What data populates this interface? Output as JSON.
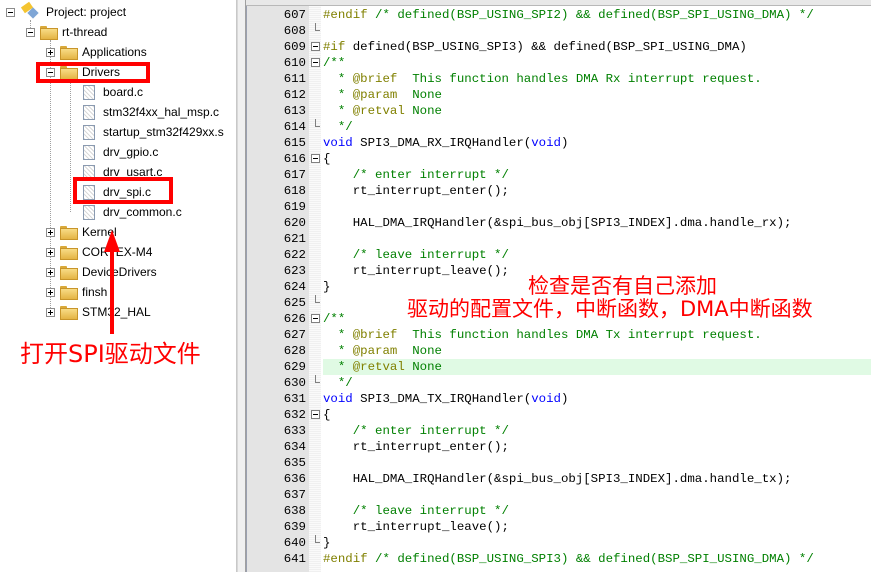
{
  "project_tree": {
    "root": "Project: project",
    "group": "rt-thread",
    "folders_before": [
      {
        "label": "Applications",
        "expanded": false
      }
    ],
    "drivers": {
      "label": "Drivers",
      "expanded": true,
      "files": [
        "board.c",
        "stm32f4xx_hal_msp.c",
        "startup_stm32f429xx.s",
        "drv_gpio.c",
        "drv_usart.c",
        "drv_spi.c",
        "drv_common.c"
      ]
    },
    "folders_after": [
      {
        "label": "Kernel",
        "expanded": false
      },
      {
        "label": "CORTEX-M4",
        "expanded": false
      },
      {
        "label": "DeviceDrivers",
        "expanded": false
      },
      {
        "label": "finsh",
        "expanded": false
      },
      {
        "label": "STM32_HAL",
        "expanded": false
      }
    ],
    "highlighted": [
      "Drivers",
      "drv_spi.c"
    ]
  },
  "annotations": {
    "left": "打开SPI驱动文件",
    "right_line1": "检查是否有自己添加",
    "right_line2": "驱动的配置文件，中断函数，DMA中断函数",
    "color": "#ff0000"
  },
  "editor": {
    "highlighted_line": 629,
    "lines": [
      {
        "n": "607",
        "fold": "none",
        "segs": [
          [
            "p",
            "#endif"
          ],
          [
            "c",
            " /* defined(BSP_USING_SPI2) && defined(BSP_SPI_USING_DMA) */"
          ]
        ]
      },
      {
        "n": "608",
        "fold": "tick",
        "segs": []
      },
      {
        "n": "609",
        "fold": "box",
        "segs": [
          [
            "p",
            "#if"
          ],
          [
            "d",
            " defined(BSP_USING_SPI3) && defined(BSP_SPI_USING_DMA)"
          ]
        ]
      },
      {
        "n": "610",
        "fold": "box",
        "segs": [
          [
            "c",
            "/**"
          ]
        ]
      },
      {
        "n": "611",
        "fold": "none",
        "segs": [
          [
            "c",
            "  * "
          ],
          [
            "p",
            "@brief"
          ],
          [
            "c",
            "  This function handles DMA Rx interrupt request."
          ]
        ]
      },
      {
        "n": "612",
        "fold": "none",
        "segs": [
          [
            "c",
            "  * "
          ],
          [
            "p",
            "@param"
          ],
          [
            "c",
            "  None"
          ]
        ]
      },
      {
        "n": "613",
        "fold": "none",
        "segs": [
          [
            "c",
            "  * "
          ],
          [
            "p",
            "@retval"
          ],
          [
            "c",
            " None"
          ]
        ]
      },
      {
        "n": "614",
        "fold": "tick",
        "segs": [
          [
            "c",
            "  */"
          ]
        ]
      },
      {
        "n": "615",
        "fold": "none",
        "segs": [
          [
            "k",
            "void"
          ],
          [
            "d",
            " SPI3_DMA_RX_IRQHandler("
          ],
          [
            "k",
            "void"
          ],
          [
            "d",
            ")"
          ]
        ]
      },
      {
        "n": "616",
        "fold": "box",
        "segs": [
          [
            "d",
            "{"
          ]
        ]
      },
      {
        "n": "617",
        "fold": "none",
        "segs": [
          [
            "c",
            "    /* enter interrupt */"
          ]
        ]
      },
      {
        "n": "618",
        "fold": "none",
        "segs": [
          [
            "d",
            "    rt_interrupt_enter();"
          ]
        ]
      },
      {
        "n": "619",
        "fold": "none",
        "segs": []
      },
      {
        "n": "620",
        "fold": "none",
        "segs": [
          [
            "d",
            "    HAL_DMA_IRQHandler(&spi_bus_obj[SPI3_INDEX].dma.handle_rx);"
          ]
        ]
      },
      {
        "n": "621",
        "fold": "none",
        "segs": []
      },
      {
        "n": "622",
        "fold": "none",
        "segs": [
          [
            "c",
            "    /* leave interrupt */"
          ]
        ]
      },
      {
        "n": "623",
        "fold": "none",
        "segs": [
          [
            "d",
            "    rt_interrupt_leave();"
          ]
        ]
      },
      {
        "n": "624",
        "fold": "none",
        "segs": [
          [
            "d",
            "}"
          ]
        ]
      },
      {
        "n": "625",
        "fold": "tick",
        "segs": []
      },
      {
        "n": "626",
        "fold": "box",
        "segs": [
          [
            "c",
            "/**"
          ]
        ]
      },
      {
        "n": "627",
        "fold": "none",
        "segs": [
          [
            "c",
            "  * "
          ],
          [
            "p",
            "@brief"
          ],
          [
            "c",
            "  This function handles DMA Tx interrupt request."
          ]
        ]
      },
      {
        "n": "628",
        "fold": "none",
        "segs": [
          [
            "c",
            "  * "
          ],
          [
            "p",
            "@param"
          ],
          [
            "c",
            "  None"
          ]
        ]
      },
      {
        "n": "629",
        "fold": "none",
        "segs": [
          [
            "c",
            "  * "
          ],
          [
            "p",
            "@retval"
          ],
          [
            "c",
            " None"
          ]
        ]
      },
      {
        "n": "630",
        "fold": "tick",
        "segs": [
          [
            "c",
            "  */"
          ]
        ]
      },
      {
        "n": "631",
        "fold": "none",
        "segs": [
          [
            "k",
            "void"
          ],
          [
            "d",
            " SPI3_DMA_TX_IRQHandler("
          ],
          [
            "k",
            "void"
          ],
          [
            "d",
            ")"
          ]
        ]
      },
      {
        "n": "632",
        "fold": "box",
        "segs": [
          [
            "d",
            "{"
          ]
        ]
      },
      {
        "n": "633",
        "fold": "none",
        "segs": [
          [
            "c",
            "    /* enter interrupt */"
          ]
        ]
      },
      {
        "n": "634",
        "fold": "none",
        "segs": [
          [
            "d",
            "    rt_interrupt_enter();"
          ]
        ]
      },
      {
        "n": "635",
        "fold": "none",
        "segs": []
      },
      {
        "n": "636",
        "fold": "none",
        "segs": [
          [
            "d",
            "    HAL_DMA_IRQHandler(&spi_bus_obj[SPI3_INDEX].dma.handle_tx);"
          ]
        ]
      },
      {
        "n": "637",
        "fold": "none",
        "segs": []
      },
      {
        "n": "638",
        "fold": "none",
        "segs": [
          [
            "c",
            "    /* leave interrupt */"
          ]
        ]
      },
      {
        "n": "639",
        "fold": "none",
        "segs": [
          [
            "d",
            "    rt_interrupt_leave();"
          ]
        ]
      },
      {
        "n": "640",
        "fold": "tick",
        "segs": [
          [
            "d",
            "}"
          ]
        ]
      },
      {
        "n": "641",
        "fold": "none",
        "segs": [
          [
            "p",
            "#endif"
          ],
          [
            "c",
            " /* defined(BSP_USING_SPI3) && defined(BSP_SPI_USING_DMA) */"
          ]
        ]
      }
    ]
  }
}
